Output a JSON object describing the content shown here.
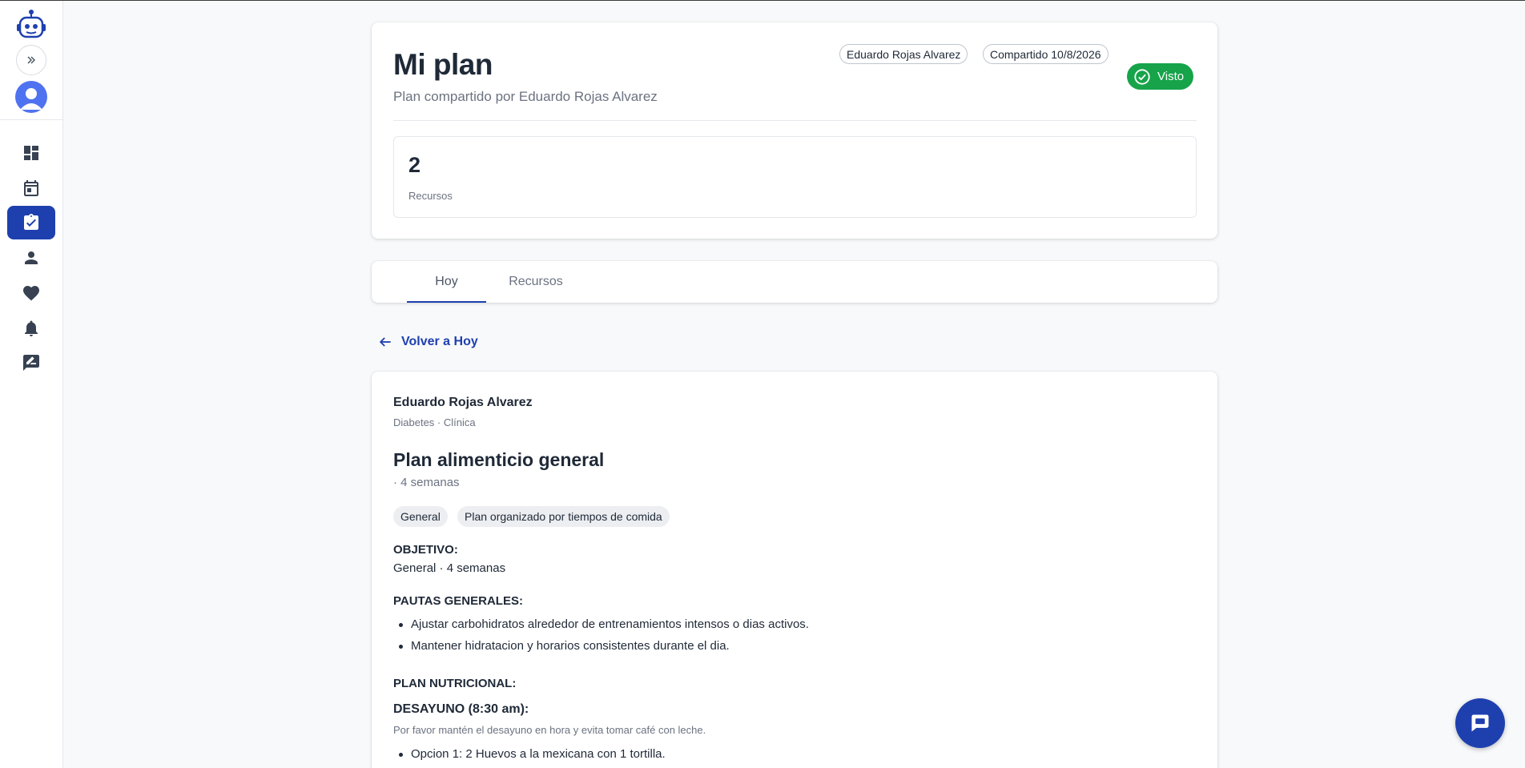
{
  "sidebar": {
    "items": [
      {
        "name": "dashboard",
        "icon": "dashboard-icon"
      },
      {
        "name": "calendar",
        "icon": "calendar-icon"
      },
      {
        "name": "plans",
        "icon": "clipboard-check-icon",
        "active": true
      },
      {
        "name": "profile",
        "icon": "person-icon"
      },
      {
        "name": "health",
        "icon": "heart-icon"
      },
      {
        "name": "notifications",
        "icon": "bell-icon"
      },
      {
        "name": "feedback",
        "icon": "rate-review-icon"
      }
    ]
  },
  "header": {
    "title": "Mi plan",
    "subtitle": "Plan compartido por Eduardo Rojas Alvarez",
    "author_chip": "Eduardo Rojas Alvarez",
    "date_chip": "Compartido 10/8/2026",
    "status": "Visto",
    "stat": {
      "value": "2",
      "label": "Recursos"
    }
  },
  "tabs": [
    {
      "label": "Hoy",
      "active": true
    },
    {
      "label": "Recursos",
      "active": false
    }
  ],
  "back_link": "Volver a Hoy",
  "plan": {
    "author": "Eduardo Rojas Alvarez",
    "author_meta": "Diabetes · Clínica",
    "title": "Plan alimenticio general",
    "duration": "· 4 semanas",
    "tags": [
      "General",
      "Plan organizado por tiempos de comida"
    ],
    "objetivo_heading": "OBJETIVO:",
    "objetivo_text": "General · 4 semanas",
    "pautas_heading": "PAUTAS GENERALES:",
    "pautas": [
      "Ajustar carbohidratos alrededor de entrenamientos intensos o dias activos.",
      "Mantener hidratacion y horarios consistentes durante el dia."
    ],
    "plan_heading": "PLAN NUTRICIONAL:",
    "desayuno_heading": "DESAYUNO (8:30 am):",
    "desayuno_note": "Por favor mantén el desayuno en hora y evita tomar café con leche.",
    "desayuno_options": [
      "Opcion 1: 2 Huevos a la mexicana con 1 tortilla."
    ]
  },
  "colors": {
    "primary": "#1e40af",
    "success": "#16a34a",
    "background": "#f8f9fb"
  }
}
